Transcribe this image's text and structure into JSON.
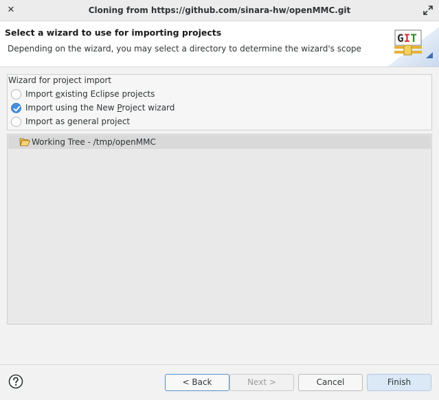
{
  "window": {
    "title": "Cloning from https://github.com/sinara-hw/openMMC.git",
    "close_glyph": "✕"
  },
  "header": {
    "title": "Select a wizard to use for importing projects",
    "description": "Depending on the wizard, you may select a directory to determine the wizard's scope",
    "logo_text": "GIT"
  },
  "wizard_group": {
    "legend": "Wizard for project import",
    "options": [
      {
        "pre": "Import ",
        "mnemonic": "e",
        "post": "xisting Eclipse projects",
        "checked": false
      },
      {
        "pre": "Import using the New ",
        "mnemonic": "P",
        "post": "roject wizard",
        "checked": true
      },
      {
        "pre": "Import as general project",
        "mnemonic": "",
        "post": "",
        "checked": false
      }
    ]
  },
  "tree": {
    "items": [
      {
        "label": "Working Tree - /tmp/openMMC",
        "icon": "folder-open-icon"
      }
    ]
  },
  "buttons": {
    "back": "< Back",
    "next": "Next >",
    "cancel": "Cancel",
    "finish": "Finish"
  },
  "colors": {
    "accent": "#4a90d9",
    "finish_bg": "#dbe8f6"
  }
}
